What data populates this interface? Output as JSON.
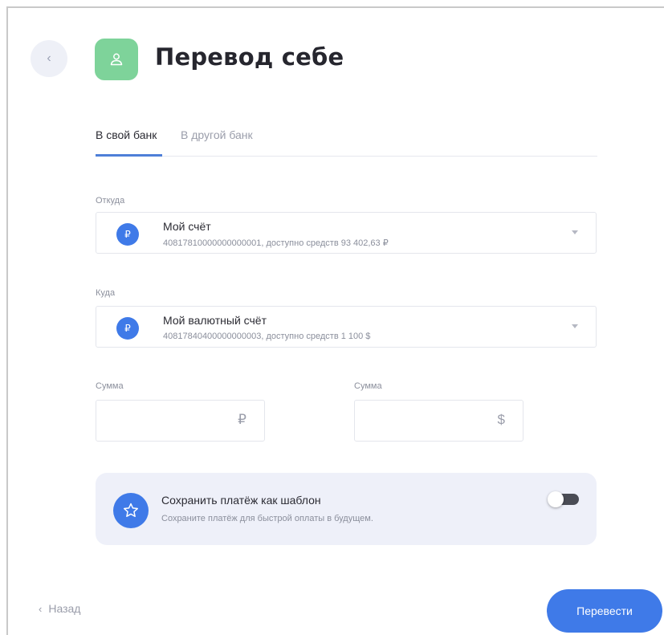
{
  "header": {
    "back_icon": "chevron-left-icon",
    "back_glyph": "‹",
    "title_icon": "person-icon",
    "title": "Перевод себе",
    "badge_color": "#7ed39a"
  },
  "tabs": [
    {
      "label": "В свой банк",
      "active": true
    },
    {
      "label": "В другой банк",
      "active": false
    }
  ],
  "from": {
    "label": "Откуда",
    "account_name": "Мой счёт",
    "account_detail": "40817810000000000001, доступно средств 93 402,63 ₽",
    "icon_glyph": "₽"
  },
  "to": {
    "label": "Куда",
    "account_name": "Мой валютный счёт",
    "account_detail": "40817840400000000003, доступно средств 1 100 $",
    "icon_glyph": "₽"
  },
  "amount_rub": {
    "label": "Сумма",
    "value": "",
    "currency": "₽"
  },
  "amount_usd": {
    "label": "Сумма",
    "value": "",
    "currency": "$"
  },
  "template": {
    "title": "Сохранить платёж как шаблон",
    "subtitle": "Сохраните платёж для быстрой оплаты в будущем.",
    "icon": "star-icon",
    "toggle_on": false
  },
  "footer": {
    "back_glyph": "‹",
    "back_label": "Назад",
    "submit_label": "Перевести"
  },
  "colors": {
    "accent": "#3f7ae8",
    "tab_underline": "#4e7fd8",
    "card_bg": "#eef0f9"
  }
}
